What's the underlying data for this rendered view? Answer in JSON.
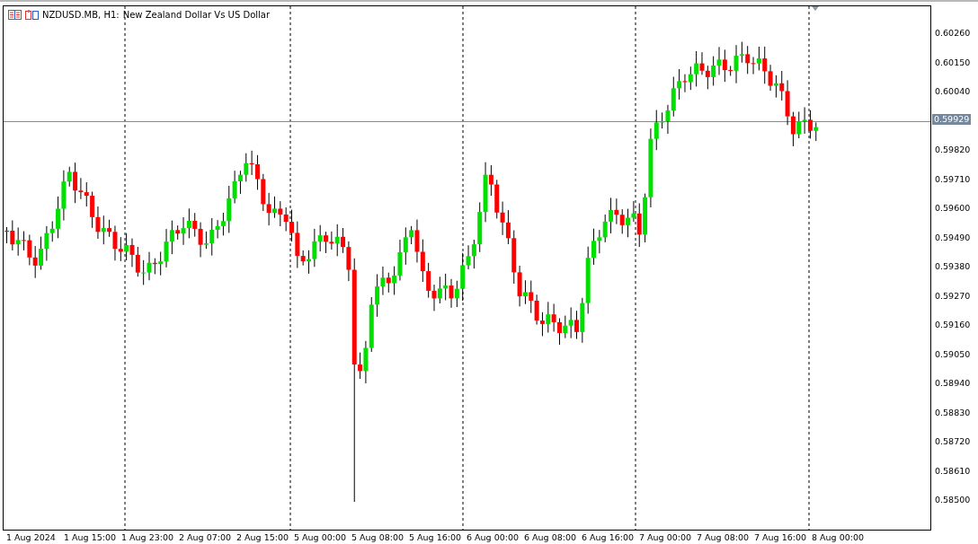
{
  "header": {
    "symbol": "NZDUSD.MB, H1:",
    "description": "New Zealand Dollar Vs US Dollar"
  },
  "price_axis": {
    "labels": [
      "0.60260",
      "0.60150",
      "0.60040",
      "0.59820",
      "0.59710",
      "0.59600",
      "0.59490",
      "0.59380",
      "0.59270",
      "0.59160",
      "0.59050",
      "0.58940",
      "0.58830",
      "0.58720",
      "0.58610",
      "0.58500"
    ],
    "bid_label": "0.59929"
  },
  "time_axis": {
    "labels": [
      "1 Aug 2024",
      "1 Aug 15:00",
      "1 Aug 23:00",
      "2 Aug 07:00",
      "2 Aug 15:00",
      "5 Aug 00:00",
      "5 Aug 08:00",
      "5 Aug 16:00",
      "6 Aug 00:00",
      "6 Aug 08:00",
      "6 Aug 16:00",
      "7 Aug 00:00",
      "7 Aug 08:00",
      "7 Aug 16:00",
      "8 Aug 00:00"
    ]
  }
}
